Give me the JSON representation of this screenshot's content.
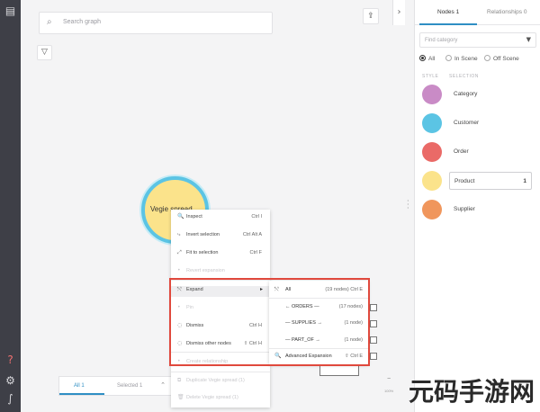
{
  "search": {
    "placeholder": "Search graph"
  },
  "node": {
    "label": "Vegie spread"
  },
  "context_menu": [
    {
      "icon": "🔍",
      "label": "Inspect",
      "shortcut": "Ctrl I",
      "enabled": true
    },
    {
      "icon": "⤷",
      "label": "Invert selection",
      "shortcut": "Ctrl Alt A",
      "enabled": true
    },
    {
      "icon": "⤢",
      "label": "Fit to selection",
      "shortcut": "Ctrl F",
      "enabled": true
    },
    {
      "icon": "•",
      "label": "Revert expansion",
      "shortcut": "",
      "enabled": false
    },
    {
      "icon": "⤲",
      "label": "Expand",
      "shortcut": "",
      "enabled": true,
      "highlighted": true,
      "submenu": true
    },
    {
      "icon": "•",
      "label": "Pin",
      "shortcut": "",
      "enabled": false
    },
    {
      "icon": "◌",
      "label": "Dismiss",
      "shortcut": "Ctrl H",
      "enabled": true
    },
    {
      "icon": "◌",
      "label": "Dismiss other nodes",
      "shortcut": "⇧ Ctrl H",
      "enabled": true
    },
    {
      "icon": "•",
      "label": "Create relationship",
      "shortcut": "",
      "enabled": false
    },
    {
      "icon": "⧉",
      "label": "Duplicate Vegie spread (1)",
      "shortcut": "",
      "enabled": false
    },
    {
      "icon": "🗑",
      "label": "Delete Vegie spread (1)",
      "shortcut": "",
      "enabled": false
    }
  ],
  "expand_submenu": [
    {
      "icon": "⤲",
      "label": "All",
      "shortcut": "(19 nodes) Ctrl E"
    },
    {
      "icon": "",
      "label": "← ORDERS —",
      "shortcut": "(17 nodes)"
    },
    {
      "icon": "",
      "label": "— SUPPLIES →",
      "shortcut": "(1 node)"
    },
    {
      "icon": "",
      "label": "— PART_OF →",
      "shortcut": "(1 node)"
    },
    {
      "icon": "🔍",
      "label": "Advanced Expansion",
      "shortcut": "⇧ Ctrl E"
    }
  ],
  "bottom_tabs": {
    "all": "All 1",
    "selected": "Selected 1"
  },
  "zoom": "100%",
  "panel": {
    "tabs": {
      "nodes": "Nodes 1",
      "relationships": "Relationships 0"
    },
    "filter_placeholder": "Find category",
    "radios": [
      "All",
      "In Scene",
      "Off Scene"
    ],
    "headers": {
      "style": "STYLE",
      "selection": "SELECTION"
    },
    "categories": [
      {
        "label": "Category",
        "color": "#c98bc6",
        "count": ""
      },
      {
        "label": "Customer",
        "color": "#5bc4e4",
        "count": ""
      },
      {
        "label": "Order",
        "color": "#ea6a67",
        "count": ""
      },
      {
        "label": "Product",
        "color": "#fbe38b",
        "count": "1"
      },
      {
        "label": "Supplier",
        "color": "#f0965c",
        "count": ""
      }
    ]
  },
  "watermark": "元码手游网"
}
